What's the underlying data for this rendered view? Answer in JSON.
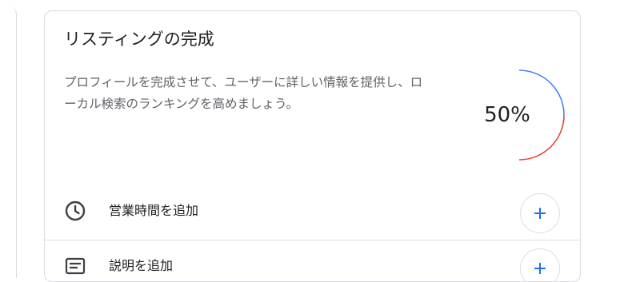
{
  "listing": {
    "title": "リスティングの完成",
    "description": "プロフィールを完成させて、ユーザーに詳しい情報を提供し、ローカル検索のランキングを高めましょう。",
    "progress_percent": 50,
    "progress_label": "50%",
    "colors": {
      "progress_primary": "#4285f4",
      "progress_secondary": "#ea4335",
      "add_icon": "#1a73e8"
    }
  },
  "tasks": [
    {
      "label": "営業時間を追加",
      "icon": "clock-icon",
      "action_icon": "plus-icon"
    },
    {
      "label": "説明を追加",
      "icon": "description-icon",
      "action_icon": "plus-icon"
    }
  ]
}
